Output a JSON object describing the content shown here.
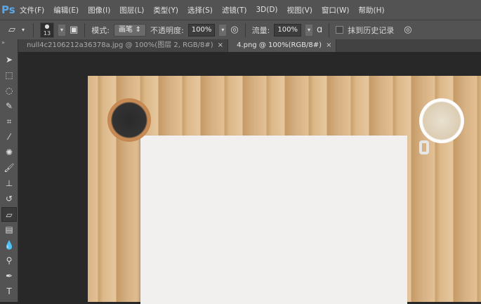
{
  "app": {
    "logo": "Ps"
  },
  "menu": [
    "文件(F)",
    "编辑(E)",
    "图像(I)",
    "图层(L)",
    "类型(Y)",
    "选择(S)",
    "滤镜(T)",
    "3D(D)",
    "视图(V)",
    "窗口(W)",
    "帮助(H)"
  ],
  "options": {
    "brush_size": "13",
    "mode_label": "模式:",
    "mode_value": "画笔",
    "opacity_label": "不透明度:",
    "opacity_value": "100%",
    "flow_label": "流量:",
    "flow_value": "100%",
    "history_label": "抹到历史记录"
  },
  "tabs": [
    {
      "label": "null4c2106212a36378a.jpg @ 100%(图层 2, RGB/8#)",
      "close": "×"
    },
    {
      "label": "4.png @ 100%(RGB/8#)",
      "close": "×"
    }
  ],
  "tools": [
    "move",
    "marquee",
    "lasso",
    "quick-selection",
    "crop",
    "eyedropper",
    "healing",
    "brush",
    "stamp",
    "history-brush",
    "eraser",
    "gradient",
    "blur",
    "dodge",
    "pen",
    "type"
  ]
}
